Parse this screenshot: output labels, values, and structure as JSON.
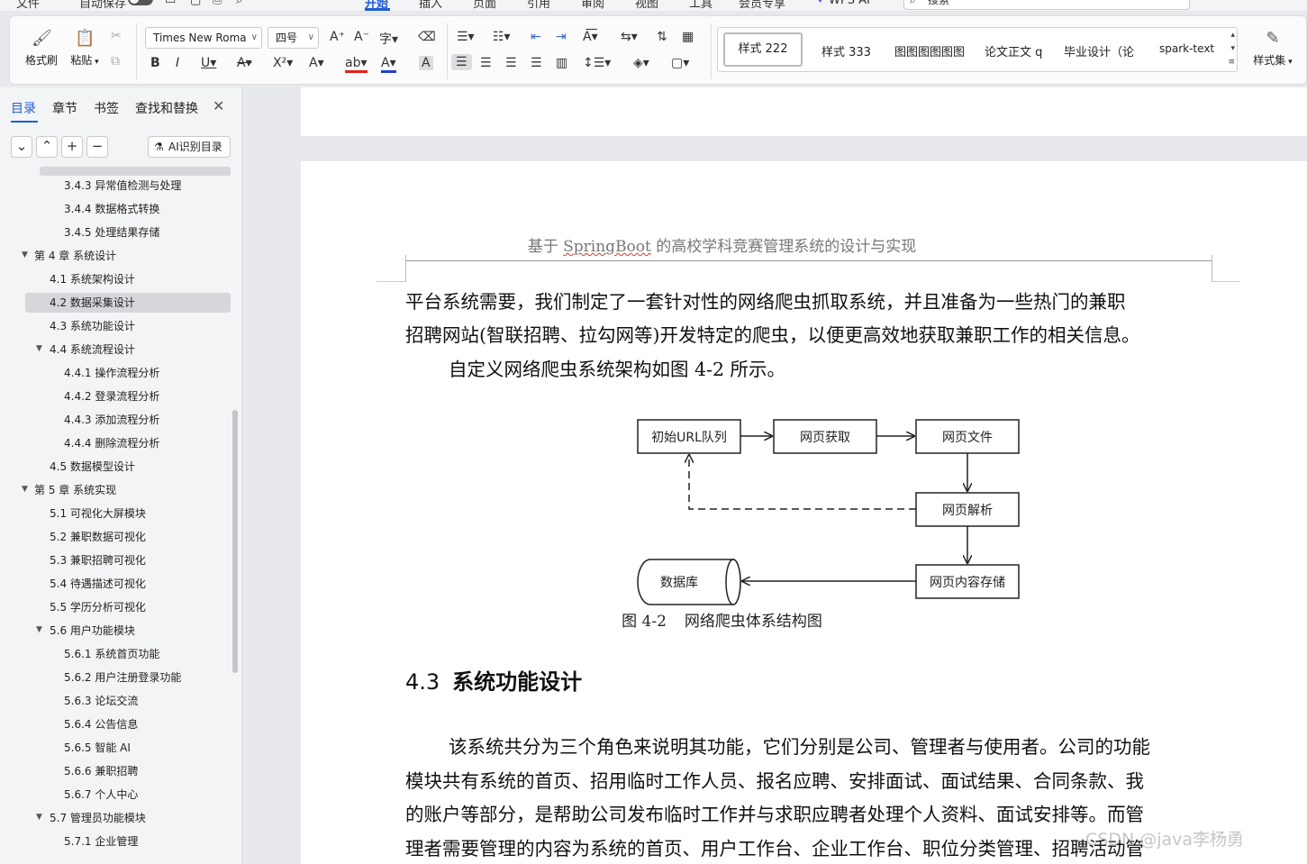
{
  "menubar": {
    "file": "文件",
    "autosave": "自动保存",
    "tabs": [
      "开始",
      "插入",
      "页面",
      "引用",
      "审阅",
      "视图",
      "工具",
      "会员专享"
    ],
    "wps_ai": "WPS AI",
    "search_placeholder": "搜索"
  },
  "ribbon": {
    "format_painter": "格式刷",
    "paste": "粘贴",
    "font_name": "Times New Roma",
    "font_size": "四号",
    "styles": {
      "selected": "样式 222",
      "items": [
        "样式 333",
        "图图图图图图",
        "论文正文 q",
        "毕业设计（论",
        "spark-text"
      ]
    },
    "style_set": "样式集"
  },
  "nav": {
    "tabs": [
      "目录",
      "章节",
      "书签",
      "查找和替换"
    ],
    "ai_button": "AI识别目录",
    "toc": [
      {
        "label": "3.4.3  异常值检测与处理"
      },
      {
        "label": "3.4.4  数据格式转换"
      },
      {
        "label": "3.4.5  处理结果存储"
      },
      {
        "label": "第 4 章  系统设计"
      },
      {
        "label": "4.1  系统架构设计"
      },
      {
        "label": "4.2  数据采集设计"
      },
      {
        "label": "4.3  系统功能设计"
      },
      {
        "label": "4.4  系统流程设计"
      },
      {
        "label": "4.4.1  操作流程分析"
      },
      {
        "label": "4.4.2  登录流程分析"
      },
      {
        "label": "4.4.3  添加流程分析"
      },
      {
        "label": "4.4.4  删除流程分析"
      },
      {
        "label": "4.5  数据模型设计"
      },
      {
        "label": "第 5 章  系统实现"
      },
      {
        "label": "5.1  可视化大屏模块"
      },
      {
        "label": "5.2  兼职数据可视化"
      },
      {
        "label": "5.3  兼职招聘可视化"
      },
      {
        "label": "5.4  待遇描述可视化"
      },
      {
        "label": "5.5  学历分析可视化"
      },
      {
        "label": "5.6  用户功能模块"
      },
      {
        "label": "5.6.1  系统首页功能"
      },
      {
        "label": "5.6.2  用户注册登录功能"
      },
      {
        "label": "5.6.3  论坛交流"
      },
      {
        "label": "5.6.4  公告信息"
      },
      {
        "label": "5.6.5  智能 AI"
      },
      {
        "label": "5.6.6  兼职招聘"
      },
      {
        "label": "5.6.7  个人中心"
      },
      {
        "label": "5.7  管理员功能模块"
      },
      {
        "label": "5.7.1  企业管理"
      }
    ]
  },
  "doc": {
    "header_pre": "基于 ",
    "header_springboot": "SpringBoot",
    "header_post": " 的高校学科竞赛管理系统的设计与实现",
    "para1_line1": "平台系统需要，我们制定了一套针对性的网络爬虫抓取系统，并且准备为一些热门的兼职",
    "para1_line2": "招聘网站(智联招聘、拉勾网等)开发特定的爬虫，以便更高效地获取兼职工作的相关信息。",
    "para1_line3": "自定义网络爬虫系统架构如图 4-2 所示。",
    "diagram": {
      "url_queue": "初始URL队列",
      "fetch": "网页获取",
      "page_file": "网页文件",
      "parse": "网页解析",
      "store": "网页内容存储",
      "database": "数据库"
    },
    "caption_num": "图  4-2",
    "caption_text": "网络爬虫体系结构图",
    "heading_num": "4.3",
    "heading_text": "系统功能设计",
    "para2_line1": "该系统共分为三个角色来说明其功能，它们分别是公司、管理者与使用者。公司的功能",
    "para2_line2": "模块共有系统的首页、招用临时工作人员、报名应聘、安排面试、面试结果、合同条款、我",
    "para2_line3": "的账户等部分，是帮助公司发布临时工作并与求职应聘者处理个人资料、面试安排等。而管",
    "para2_line4": "理者需要管理的内容为系统的首页、用户工作台、企业工作台、职位分类管理、招聘活动管"
  },
  "watermark": "CSDN @java李杨勇"
}
